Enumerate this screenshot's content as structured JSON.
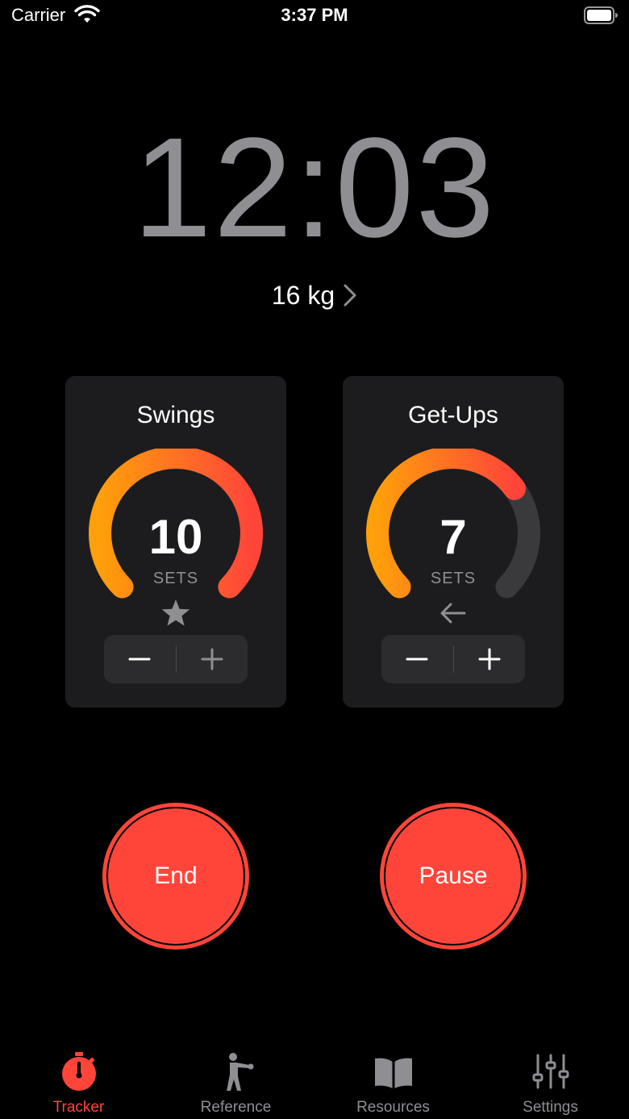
{
  "status_bar": {
    "carrier": "Carrier",
    "time": "3:37 PM",
    "wifi_icon": "wifi-icon",
    "battery_icon": "battery-icon"
  },
  "timer": {
    "display": "12:03"
  },
  "weight": {
    "label": "16 kg",
    "chevron_icon": "chevron-right-icon"
  },
  "exercises": [
    {
      "title": "Swings",
      "value": "10",
      "unit": "SETS",
      "progress": 1.0,
      "status_icon": "star-icon",
      "minus_icon": "minus-icon",
      "plus_icon": "plus-icon"
    },
    {
      "title": "Get-Ups",
      "value": "7",
      "unit": "SETS",
      "progress": 0.7,
      "status_icon": "arrow-left-icon",
      "minus_icon": "minus-icon",
      "plus_icon": "plus-icon"
    }
  ],
  "buttons": {
    "end_label": "End",
    "pause_label": "Pause"
  },
  "tabs": [
    {
      "label": "Tracker",
      "icon": "stopwatch-icon",
      "active": true
    },
    {
      "label": "Reference",
      "icon": "figure-icon",
      "active": false
    },
    {
      "label": "Resources",
      "icon": "book-icon",
      "active": false
    },
    {
      "label": "Settings",
      "icon": "sliders-icon",
      "active": false
    }
  ],
  "colors": {
    "accent": "#ff453a",
    "gauge_start": "#ff9f0a",
    "gauge_end": "#ff453a",
    "gauge_track": "#3a3a3c",
    "card_bg": "#1c1c1e",
    "timer": "#8e8e93"
  }
}
